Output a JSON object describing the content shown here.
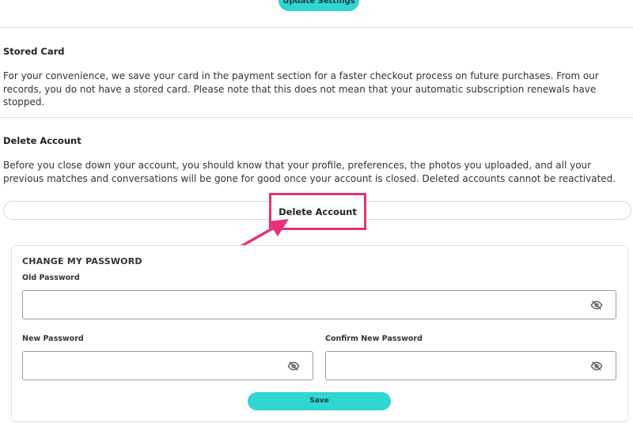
{
  "top_button": {
    "label": "Update Settings"
  },
  "stored_card": {
    "heading": "Stored Card",
    "text": "For your convenience, we save your card in the payment section for a faster checkout process on future purchases. From our records, you do not have a stored card. Please note that this does not mean that your automatic subscription renewals have stopped."
  },
  "delete_account": {
    "heading": "Delete Account",
    "text": "Before you close down your account, you should know that your profile, preferences, the photos you uploaded, and all your previous matches and conversations will be gone for good once your account is closed. Deleted accounts cannot be reactivated.",
    "button_label": "Delete Account"
  },
  "password": {
    "title": "CHANGE MY PASSWORD",
    "old_label": "Old Password",
    "new_label": "New Password",
    "confirm_label": "Confirm New Password",
    "old_value": "",
    "new_value": "",
    "confirm_value": "",
    "save_label": "Save"
  },
  "colors": {
    "accent": "#2fd6d2",
    "highlight": "#e8317a"
  },
  "icons": {
    "eye": "eye-slash-icon",
    "arrow": "annotation-arrow"
  }
}
